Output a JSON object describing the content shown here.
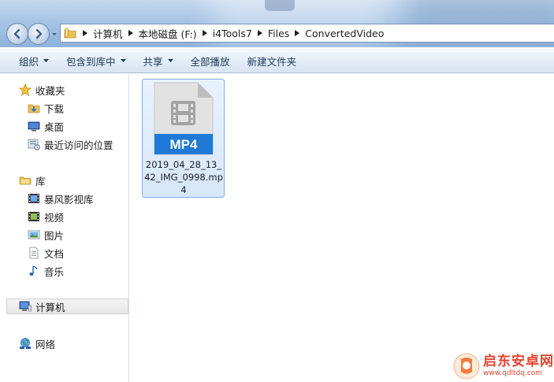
{
  "breadcrumb": [
    {
      "label": "计算机"
    },
    {
      "label": "本地磁盘 (F:)"
    },
    {
      "label": "i4Tools7"
    },
    {
      "label": "Files"
    },
    {
      "label": "ConvertedVideo"
    }
  ],
  "toolbar": {
    "organize": "组织",
    "include_in_library": "包含到库中",
    "share": "共享",
    "play_all": "全部播放",
    "new_folder": "新建文件夹"
  },
  "sidebar": {
    "favorites": {
      "label": "收藏夹",
      "items": [
        {
          "label": "下载",
          "icon": "download-folder-icon"
        },
        {
          "label": "桌面",
          "icon": "desktop-icon"
        },
        {
          "label": "最近访问的位置",
          "icon": "recent-places-icon"
        }
      ]
    },
    "libraries": {
      "label": "库",
      "items": [
        {
          "label": "暴风影视库",
          "icon": "video-library-icon"
        },
        {
          "label": "视频",
          "icon": "videos-icon"
        },
        {
          "label": "图片",
          "icon": "pictures-icon"
        },
        {
          "label": "文档",
          "icon": "documents-icon"
        },
        {
          "label": "音乐",
          "icon": "music-icon"
        }
      ]
    },
    "computer": {
      "label": "计算机",
      "icon": "computer-icon"
    },
    "network": {
      "label": "网络",
      "icon": "network-icon"
    }
  },
  "files": [
    {
      "name": "2019_04_28_13_42_IMG_0998.mp4",
      "badge": "MP4",
      "icon": "mp4-file-icon"
    }
  ],
  "watermark": {
    "brand": "启东安卓网",
    "url": "www.qdltdq.com"
  },
  "colors": {
    "accent": "#1e7ad6",
    "selection_bg": "#d6e7fb",
    "selection_border": "#84acdd",
    "watermark": "#e5432f"
  }
}
